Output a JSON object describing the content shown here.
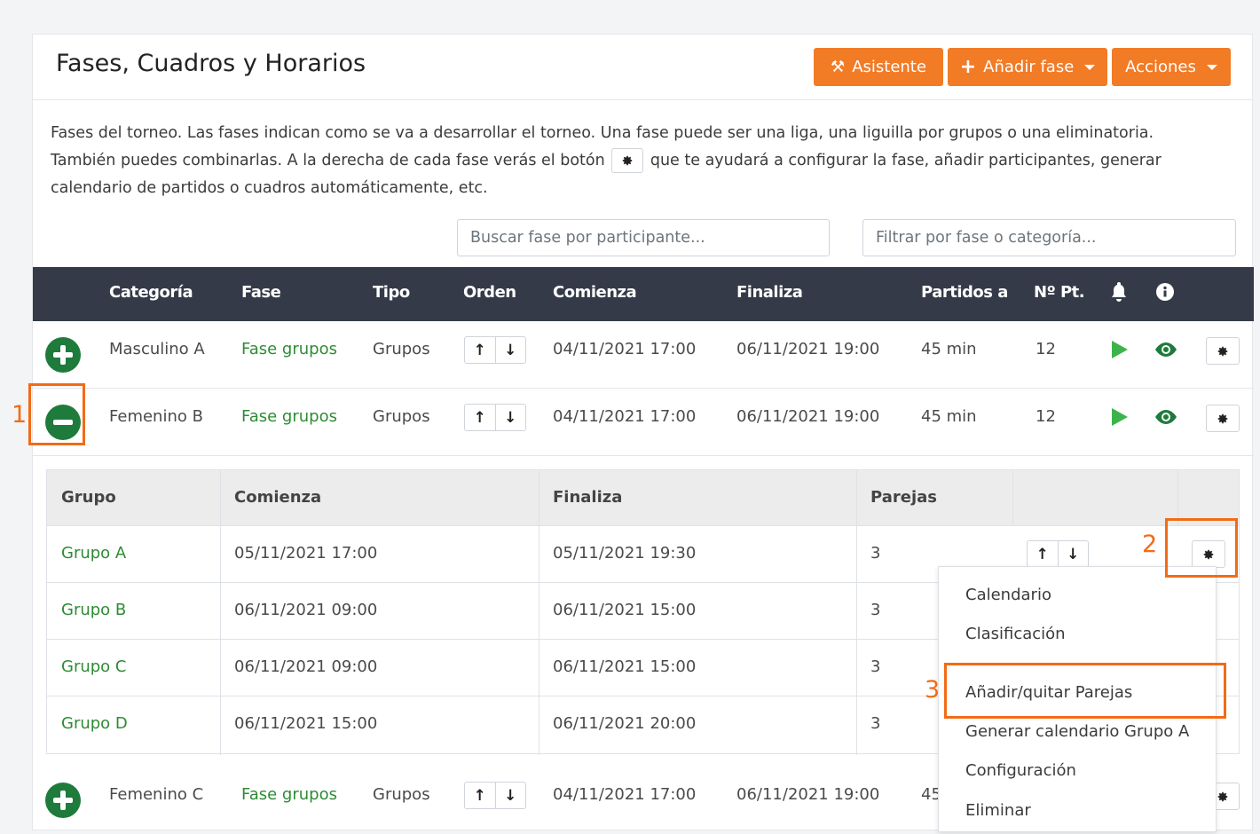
{
  "header": {
    "title": "Fases, Cuadros y Horarios",
    "buttons": {
      "wizard": "Asistente",
      "add_phase": "Añadir fase",
      "actions": "Acciones"
    }
  },
  "description": {
    "part1": "Fases del torneo. Las fases indican como se va a desarrollar el torneo. Una fase puede ser una liga, una liguilla por grupos o una eliminatoria. También puedes combinarlas. A la derecha de cada fase verás el botón",
    "part2": "que te ayudará a configurar la fase, añadir participantes, generar calendario de partidos o cuadros automáticamente, etc."
  },
  "search": {
    "participant_placeholder": "Buscar fase por participante...",
    "filter_placeholder": "Filtrar por fase o categoría..."
  },
  "table": {
    "columns": [
      "Categoría",
      "Fase",
      "Tipo",
      "Orden",
      "Comienza",
      "Finaliza",
      "Partidos a",
      "Nº Pt."
    ],
    "rows": [
      {
        "category": "Masculino A",
        "phase": "Fase grupos",
        "type": "Grupos",
        "start": "04/11/2021 17:00",
        "end": "06/11/2021 19:00",
        "matches": "45 min",
        "points": "12"
      },
      {
        "category": "Femenino B",
        "phase": "Fase grupos",
        "type": "Grupos",
        "start": "04/11/2021 17:00",
        "end": "06/11/2021 19:00",
        "matches": "45 min",
        "points": "12"
      },
      {
        "category": "Femenino C",
        "phase": "Fase grupos",
        "type": "Grupos",
        "start": "04/11/2021 17:00",
        "end": "06/11/2021 19:00",
        "matches": "45",
        "points": ""
      }
    ]
  },
  "groups": {
    "columns": [
      "Grupo",
      "Comienza",
      "Finaliza",
      "Parejas"
    ],
    "rows": [
      {
        "name": "Grupo A",
        "start": "05/11/2021 17:00",
        "end": "05/11/2021 19:30",
        "pairs": "3"
      },
      {
        "name": "Grupo B",
        "start": "06/11/2021 09:00",
        "end": "06/11/2021 15:00",
        "pairs": "3"
      },
      {
        "name": "Grupo C",
        "start": "06/11/2021 09:00",
        "end": "06/11/2021 15:00",
        "pairs": "3"
      },
      {
        "name": "Grupo D",
        "start": "06/11/2021 15:00",
        "end": "06/11/2021 20:00",
        "pairs": "3"
      }
    ]
  },
  "dropdown": {
    "items": [
      "Calendario",
      "Clasificación",
      "Añadir/quitar Parejas",
      "Generar calendario Grupo A",
      "Configuración",
      "Eliminar"
    ]
  },
  "callouts": [
    "1",
    "2",
    "3"
  ],
  "colors": {
    "accent": "#f27b26",
    "header_bg": "#343a47",
    "link_green": "#2e8b34",
    "highlight": "#f26b16"
  }
}
